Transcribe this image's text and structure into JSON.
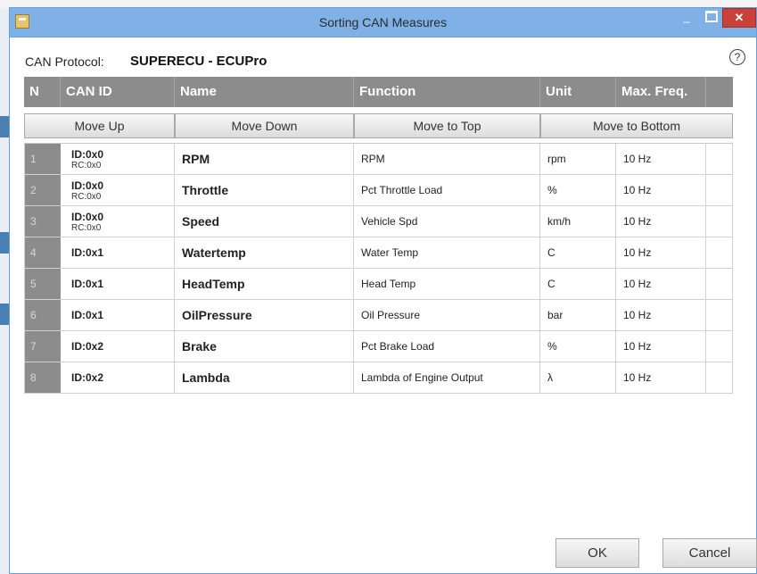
{
  "window": {
    "title": "Sorting CAN Measures",
    "minimize_glyph": "_",
    "close_glyph": "✕"
  },
  "protocol": {
    "label": "CAN Protocol:",
    "value": "SUPERECU - ECUPro"
  },
  "help_glyph": "?",
  "columns": [
    "N",
    "CAN ID",
    "Name",
    "Function",
    "Unit",
    "Max. Freq."
  ],
  "buttons": {
    "move_up": "Move Up",
    "move_down": "Move Down",
    "move_top": "Move to Top",
    "move_bottom": "Move to Bottom",
    "ok": "OK",
    "cancel": "Cancel"
  },
  "rows": [
    {
      "n": "1",
      "can_id": "ID:0x0",
      "rc": "RC:0x0",
      "name": "RPM",
      "function": "RPM",
      "unit": "rpm",
      "freq": "10 Hz"
    },
    {
      "n": "2",
      "can_id": "ID:0x0",
      "rc": "RC:0x0",
      "name": "Throttle",
      "function": "Pct Throttle Load",
      "unit": "%",
      "freq": "10 Hz"
    },
    {
      "n": "3",
      "can_id": "ID:0x0",
      "rc": "RC:0x0",
      "name": "Speed",
      "function": "Vehicle Spd",
      "unit": "km/h",
      "freq": "10 Hz"
    },
    {
      "n": "4",
      "can_id": "ID:0x1",
      "rc": "",
      "name": "Watertemp",
      "function": "Water Temp",
      "unit": "C",
      "freq": "10 Hz"
    },
    {
      "n": "5",
      "can_id": "ID:0x1",
      "rc": "",
      "name": "HeadTemp",
      "function": "Head Temp",
      "unit": "C",
      "freq": "10 Hz"
    },
    {
      "n": "6",
      "can_id": "ID:0x1",
      "rc": "",
      "name": "OilPressure",
      "function": "Oil Pressure",
      "unit": "bar",
      "freq": "10 Hz"
    },
    {
      "n": "7",
      "can_id": "ID:0x2",
      "rc": "",
      "name": "Brake",
      "function": "Pct Brake Load",
      "unit": "%",
      "freq": "10 Hz"
    },
    {
      "n": "8",
      "can_id": "ID:0x2",
      "rc": "",
      "name": "Lambda",
      "function": "Lambda of Engine Output",
      "unit": "λ",
      "freq": "10 Hz"
    }
  ],
  "colors": {
    "titlebar": "#7fb0e6",
    "header": "#8c8c8c",
    "close": "#c8423a"
  },
  "icons": {
    "app": "app-icon",
    "help": "help-icon"
  }
}
